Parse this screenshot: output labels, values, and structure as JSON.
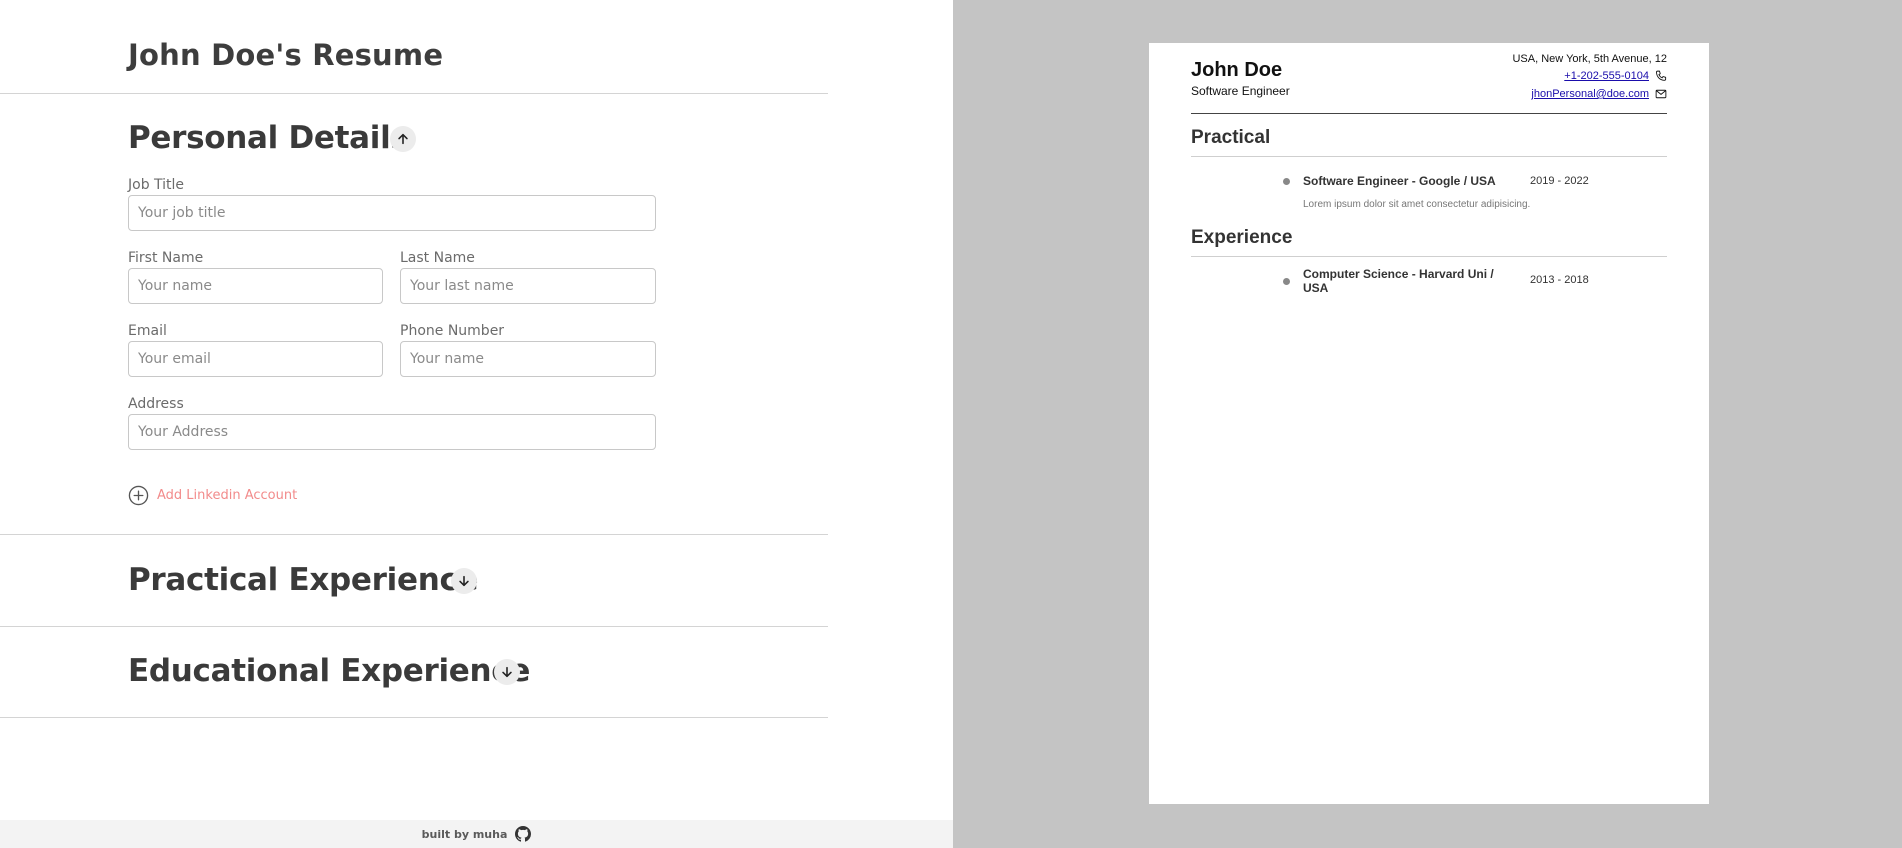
{
  "editor": {
    "app_title": "John Doe's Resume",
    "personal": {
      "title": "Personal Details",
      "toggle_icon": "arrow-up-icon",
      "job_title_label": "Job Title",
      "job_title_placeholder": "Your job title",
      "first_name_label": "First Name",
      "first_name_placeholder": "Your name",
      "last_name_label": "Last Name",
      "last_name_placeholder": "Your last name",
      "email_label": "Email",
      "email_placeholder": "Your email",
      "phone_label": "Phone Number",
      "phone_placeholder": "Your name",
      "address_label": "Address",
      "address_placeholder": "Your Address",
      "add_linkedin_label": "Add Linkedin Account"
    },
    "practical": {
      "title": "Practical Experience",
      "toggle_icon": "arrow-down-icon"
    },
    "educational": {
      "title": "Educational Experience",
      "toggle_icon": "arrow-down-icon"
    },
    "footer": {
      "text": "built by muha",
      "icon": "github-icon"
    }
  },
  "preview": {
    "name": "John Doe",
    "job_title": "Software Engineer",
    "address": "USA, New York, 5th Avenue, 12",
    "phone": "+1-202-555-0104",
    "email": "jhonPersonal@doe.com",
    "sections": [
      {
        "title": "Practical",
        "items": [
          {
            "title": "Software Engineer  - Google / USA",
            "dates": "2019 - 2022",
            "description": "Lorem ipsum dolor sit amet consectetur adipisicing."
          }
        ]
      },
      {
        "title": "Experience",
        "items": [
          {
            "title": "Computer Science - Harvard Uni / USA",
            "dates": "2013 - 2018"
          }
        ]
      }
    ]
  },
  "colors": {
    "preview_background": "#c4c4c4",
    "link_accent": "#f28b8b",
    "link_blue": "#1a0dab"
  }
}
